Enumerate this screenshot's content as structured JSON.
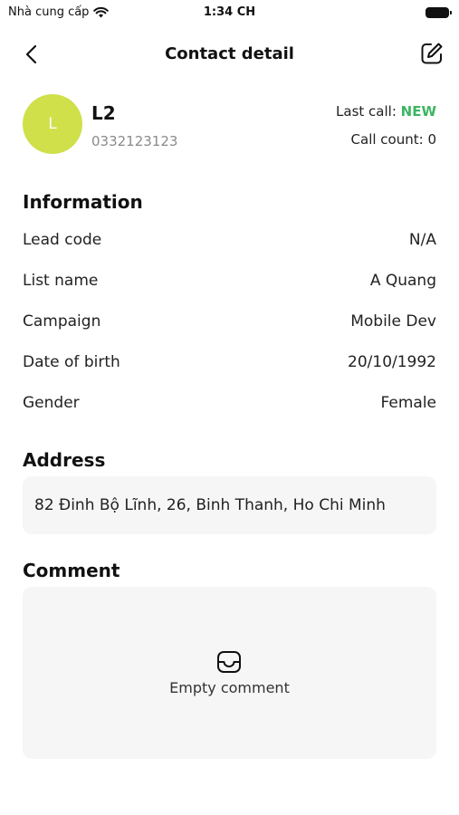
{
  "status_bar": {
    "carrier": "Nhà cung cấp",
    "time": "1:34 CH"
  },
  "nav": {
    "title": "Contact detail",
    "back_icon": "chevron-left-icon",
    "edit_icon": "edit-icon"
  },
  "contact": {
    "avatar_initial": "L",
    "avatar_color": "#cfe04a",
    "name": "L2",
    "phone": "0332123123",
    "last_call_label": "Last call: ",
    "last_call_status": "NEW",
    "last_call_status_color": "#3cb562",
    "call_count_label": "Call count: ",
    "call_count": "0"
  },
  "information": {
    "title": "Information",
    "rows": [
      {
        "label": "Lead code",
        "value": "N/A"
      },
      {
        "label": "List name",
        "value": "A Quang"
      },
      {
        "label": "Campaign",
        "value": "Mobile Dev"
      },
      {
        "label": "Date of birth",
        "value": "20/10/1992"
      },
      {
        "label": "Gender",
        "value": "Female"
      }
    ]
  },
  "address": {
    "title": "Address",
    "text": "82 Đinh Bộ Lĩnh, 26, Binh Thanh, Ho Chi Minh"
  },
  "comment": {
    "title": "Comment",
    "empty_icon": "inbox-icon",
    "empty_text": "Empty comment"
  }
}
